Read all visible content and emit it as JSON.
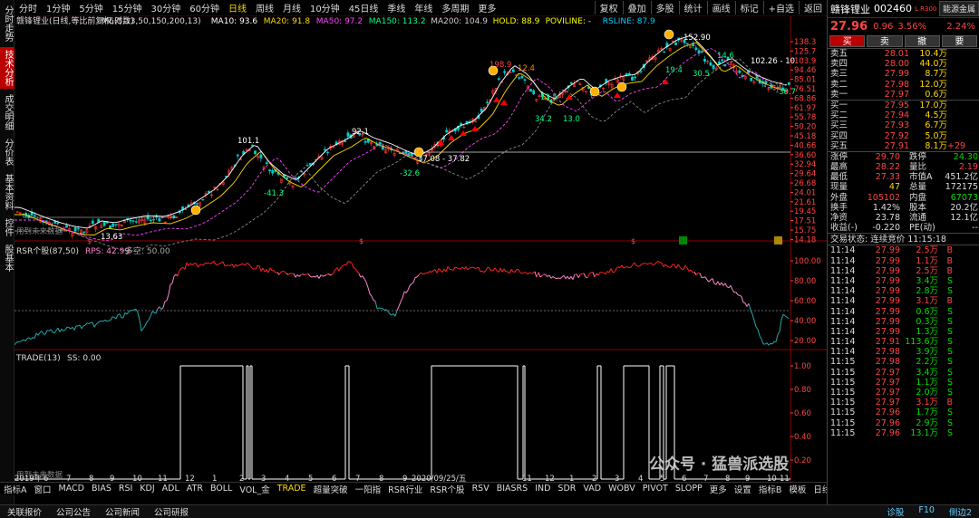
{
  "topbar": {
    "items": [
      "分时",
      "1分钟",
      "5分钟",
      "15分钟",
      "30分钟",
      "60分钟",
      "日线",
      "周线",
      "月线",
      "10分钟",
      "45日线",
      "季线",
      "年线",
      "多周期",
      "更多"
    ],
    "right": [
      "复权",
      "叠加",
      "多股",
      "统计",
      "画线",
      "标记",
      "+自选",
      "返回"
    ]
  },
  "sidebar": {
    "tabs": [
      "分时走势",
      "技术分析",
      "成交明细",
      "分价表",
      "基本资料",
      "控件",
      "股基本"
    ]
  },
  "chart": {
    "main_legend": {
      "name": "赣锋锂业(日线,等比前复权,对数)",
      "ma": "M6(5,13,50,150,200,13)",
      "ma10": "MA10: 93.6",
      "ma20": "MA20: 91.8",
      "ma50": "MA50: 97.2",
      "ma150": "MA150: 113.2",
      "ma200": "MA200: 104.9",
      "hold": "HOLD: 88.9",
      "poviline": "POVILINE: -",
      "rsline": "RSLINE: 87.9"
    },
    "price_axis": [
      "138.3",
      "125.7",
      "103.9",
      "94.46",
      "85.01",
      "76.51",
      "68.86",
      "61.97",
      "55.78",
      "50.20",
      "45.18",
      "40.66",
      "36.60",
      "32.94",
      "29.64",
      "26.68",
      "24.01",
      "21.61",
      "19.45",
      "17.51",
      "15.75",
      "14.18"
    ],
    "annotations": [
      "152.90",
      "102.26 - 10",
      "37.08 - 37.82",
      "92.1",
      "101.1",
      "13.63",
      "-41.3",
      "-32.6",
      "-30.7",
      "30.5",
      "14.6",
      "12.4",
      "198.9",
      "13.5",
      "34.2",
      "13.0",
      "19.4"
    ],
    "future_label": "用到未来数据",
    "rsr_legend": {
      "name": "RSR个股(87,50)",
      "rps": "RPS: 42.99",
      "dk": "多空: 50.00"
    },
    "rsr_axis": [
      "100.00",
      "80.00",
      "60.00",
      "40.00",
      "20.00"
    ],
    "trade_legend": {
      "name": "TRADE(13)",
      "ss": "SS: 0.00"
    },
    "trade_axis": [
      "1.00",
      "0.80",
      "0.60",
      "0.40",
      "0.20"
    ],
    "date_axis": [
      "2019年",
      "6",
      "7",
      "8",
      "9",
      "10",
      "11",
      "12",
      "1",
      "2",
      "3",
      "4",
      "5",
      "6",
      "7",
      "8",
      "9",
      "2020/09/25/五",
      "11",
      "12",
      "1",
      "2",
      "3",
      "4",
      "5",
      "6",
      "7",
      "8",
      "9",
      "10",
      "11",
      "12",
      "1",
      "2"
    ],
    "watermark": "公众号 · 猛兽派选股"
  },
  "bottomtabs": [
    "指标A",
    "窗口",
    "MACD",
    "BIAS",
    "RSI",
    "KDJ",
    "ADL",
    "ATR",
    "BOLL",
    "VOL_金",
    "TRADE",
    "超量突破",
    "一阳指",
    "RSR行业",
    "RSR个股",
    "RSV",
    "BIASRS",
    "IND",
    "SDR",
    "VAD",
    "WOBV",
    "PIVOT",
    "SLOPP",
    "更多",
    "设置"
  ],
  "bottomright": [
    "指标B",
    "模板",
    "日线"
  ],
  "statusbar": [
    "关联报价",
    "公司公告",
    "公司新闻",
    "公司研报"
  ],
  "statusright": [
    "诊股",
    "F10",
    "侧边2"
  ],
  "panel": {
    "title": "赣锋锂业",
    "code": "002460",
    "badge": "L R300",
    "price": "27.96",
    "change": "0.96",
    "pct": "3.56%",
    "sector": "能源金属",
    "sector_pct": "2.24%",
    "actions": [
      "买",
      "卖",
      "撤",
      "要"
    ],
    "asks": [
      {
        "l": "卖五",
        "p": "28.01",
        "v": "10.4万"
      },
      {
        "l": "卖四",
        "p": "28.00",
        "v": "44.0万"
      },
      {
        "l": "卖三",
        "p": "27.99",
        "v": "8.7万"
      },
      {
        "l": "卖二",
        "p": "27.98",
        "v": "12.0万"
      },
      {
        "l": "卖一",
        "p": "27.97",
        "v": "0.6万"
      }
    ],
    "bids": [
      {
        "l": "买一",
        "p": "27.95",
        "v": "17.0万"
      },
      {
        "l": "买二",
        "p": "27.94",
        "v": "4.5万"
      },
      {
        "l": "买三",
        "p": "27.93",
        "v": "6.7万"
      },
      {
        "l": "买四",
        "p": "27.92",
        "v": "5.0万"
      },
      {
        "l": "买五",
        "p": "27.91",
        "v": "8.1万",
        "x": "+29"
      }
    ],
    "stats": [
      [
        "涨停",
        "29.70",
        "跌停",
        "24.30"
      ],
      [
        "最高",
        "28.22",
        "量比",
        "2.19"
      ],
      [
        "最低",
        "27.33",
        "市值A",
        "451.2亿"
      ],
      [
        "现量",
        "47",
        "总量",
        "172175"
      ],
      [
        "外盘",
        "105102",
        "内盘",
        "67073"
      ],
      [
        "换手",
        "1.42%",
        "股本",
        "20.2亿"
      ],
      [
        "净资",
        "23.78",
        "流通",
        "12.1亿"
      ],
      [
        "收益(-)",
        "-0.220",
        "PE(动)",
        "--"
      ]
    ],
    "trade_status": "交易状态: 连续竞价 11:15:18",
    "ticks": [
      [
        "11:14",
        "27.99",
        "2.5万",
        "B"
      ],
      [
        "11:14",
        "27.99",
        "1.1万",
        "B"
      ],
      [
        "11:14",
        "27.99",
        "2.5万",
        "B"
      ],
      [
        "11:14",
        "27.99",
        "3.4万",
        "S"
      ],
      [
        "11:14",
        "27.99",
        "2.8万",
        "S"
      ],
      [
        "11:14",
        "27.99",
        "3.1万",
        "B"
      ],
      [
        "11:14",
        "27.99",
        "0.6万",
        "S"
      ],
      [
        "11:14",
        "27.99",
        "0.3万",
        "S"
      ],
      [
        "11:14",
        "27.99",
        "1.3万",
        "S"
      ],
      [
        "11:14",
        "27.91",
        "113.6万",
        "S"
      ],
      [
        "11:14",
        "27.98",
        "3.9万",
        "S"
      ],
      [
        "11:15",
        "27.98",
        "2.2万",
        "S"
      ],
      [
        "11:15",
        "27.97",
        "3.4万",
        "S"
      ],
      [
        "11:15",
        "27.97",
        "1.1万",
        "S"
      ],
      [
        "11:15",
        "27.97",
        "2.0万",
        "S"
      ],
      [
        "11:15",
        "27.97",
        "3.1万",
        "B"
      ],
      [
        "11:15",
        "27.96",
        "1.7万",
        "S"
      ],
      [
        "11:15",
        "27.96",
        "2.9万",
        "S"
      ],
      [
        "11:15",
        "27.96",
        "13.1万",
        "S"
      ]
    ]
  },
  "colors": {
    "up": "#ff4444",
    "down": "#00dd00",
    "accent": "#ffd700",
    "rsr_high": "#ff2222",
    "rsr_mid": "#ff88cc",
    "rsr_low": "#22aaaa"
  }
}
